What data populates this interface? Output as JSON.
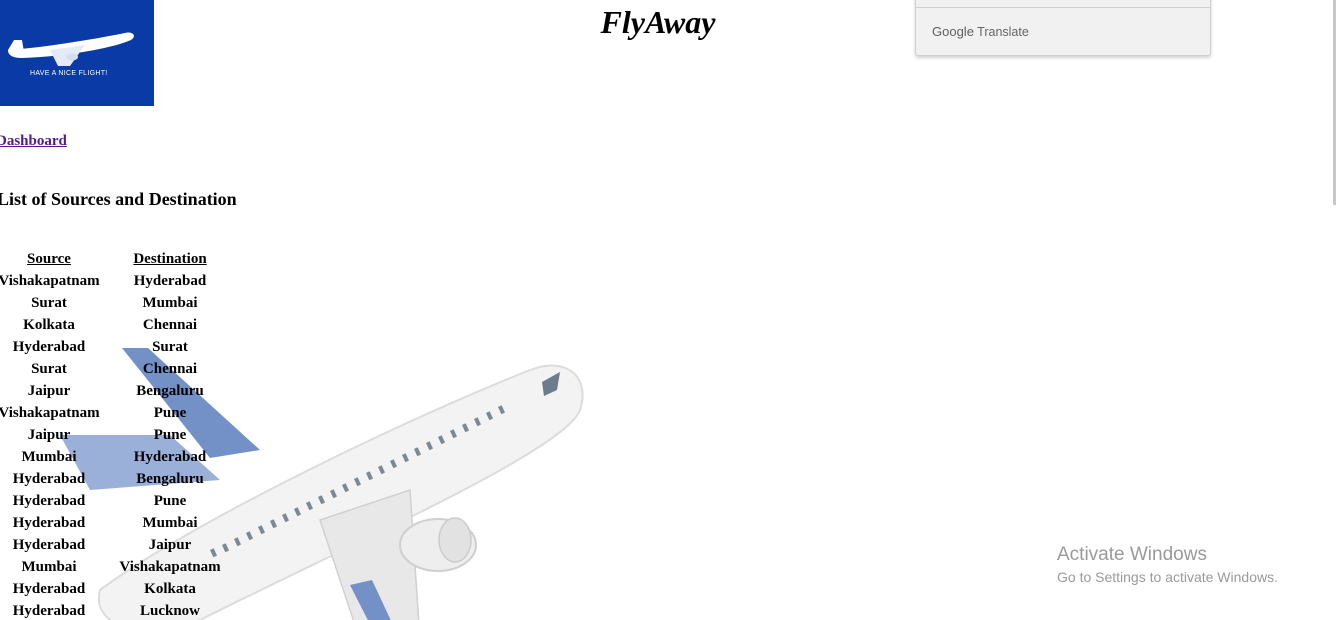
{
  "brand": {
    "logo_tagline": "HAVE A NICE FLIGHT!",
    "title": "FlyAway",
    "logo_bg": "#0a3aa6"
  },
  "translate": {
    "google": "Google",
    "label": "Translate"
  },
  "nav": {
    "dashboard_link": "Dashboard"
  },
  "content": {
    "heading": "List of Sources and Destination",
    "columns": {
      "source": "Source",
      "destination": "Destination"
    },
    "rows": [
      {
        "source": "Vishakapatnam",
        "destination": "Hyderabad"
      },
      {
        "source": "Surat",
        "destination": "Mumbai"
      },
      {
        "source": "Kolkata",
        "destination": "Chennai"
      },
      {
        "source": "Hyderabad",
        "destination": "Surat"
      },
      {
        "source": "Surat",
        "destination": "Chennai"
      },
      {
        "source": "Jaipur",
        "destination": "Bengaluru"
      },
      {
        "source": "Vishakapatnam",
        "destination": "Pune"
      },
      {
        "source": "Jaipur",
        "destination": "Pune"
      },
      {
        "source": "Mumbai",
        "destination": "Hyderabad"
      },
      {
        "source": "Hyderabad",
        "destination": "Bengaluru"
      },
      {
        "source": "Hyderabad",
        "destination": "Pune"
      },
      {
        "source": "Hyderabad",
        "destination": "Mumbai"
      },
      {
        "source": "Hyderabad",
        "destination": "Jaipur"
      },
      {
        "source": "Mumbai",
        "destination": "Vishakapatnam"
      },
      {
        "source": "Hyderabad",
        "destination": "Kolkata"
      },
      {
        "source": "Hyderabad",
        "destination": "Lucknow"
      }
    ]
  },
  "windows_watermark": {
    "line1": "Activate Windows",
    "line2": "Go to Settings to activate Windows."
  }
}
